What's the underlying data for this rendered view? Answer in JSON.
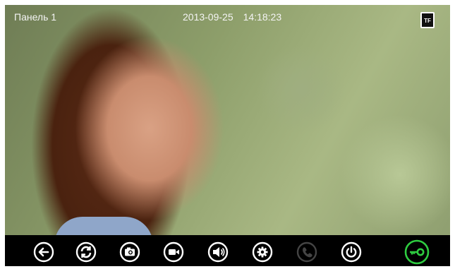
{
  "header": {
    "panel_label": "Панель 1",
    "date": "2013-09-25",
    "time": "14:18:23",
    "storage_badge": "TF"
  },
  "toolbar": {
    "buttons": [
      {
        "name": "back",
        "icon": "back-arrow-icon"
      },
      {
        "name": "switch-camera",
        "icon": "refresh-icon"
      },
      {
        "name": "snapshot",
        "icon": "camera-icon"
      },
      {
        "name": "record-video",
        "icon": "video-camera-icon"
      },
      {
        "name": "talk",
        "icon": "speaker-icon"
      },
      {
        "name": "settings",
        "icon": "gear-icon"
      },
      {
        "name": "call",
        "icon": "phone-icon",
        "disabled": true
      },
      {
        "name": "power",
        "icon": "power-icon"
      },
      {
        "name": "unlock",
        "icon": "key-icon",
        "accent": "#2ecc40"
      }
    ]
  },
  "colors": {
    "icon": "#ffffff",
    "disabled_icon": "#444444",
    "unlock_accent": "#2ecc40",
    "toolbar_bg": "#000000"
  }
}
